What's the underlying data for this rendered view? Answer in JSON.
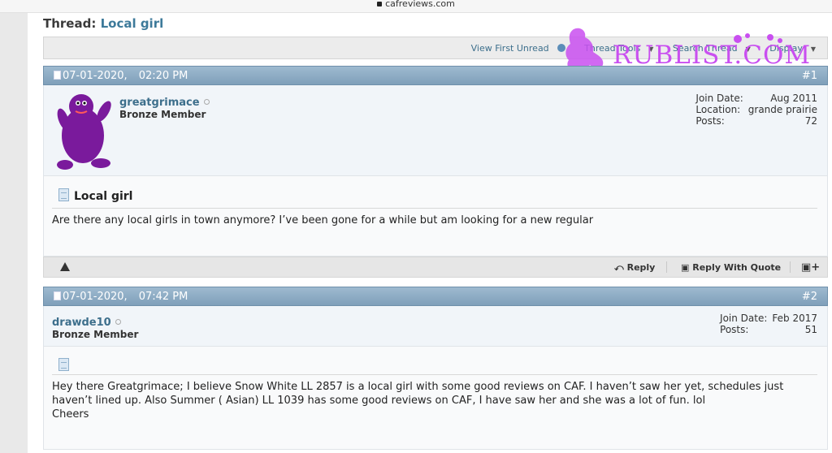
{
  "browser": {
    "url": "cafreviews.com"
  },
  "thread": {
    "label": "Thread:",
    "title": "Local girl",
    "toolbar": {
      "view_first_unread": "View First Unread",
      "thread_tools": "Thread Tools",
      "search_thread": "Search Thread",
      "display": "Display"
    }
  },
  "watermark": {
    "text": "RUBLIST.COM",
    "color": "#c94ff0"
  },
  "posts": [
    {
      "date": "07-01-2020,",
      "time": "02:20 PM",
      "number": "#1",
      "username": "greatgrimace",
      "rank": "Bronze Member",
      "stats": {
        "join_label": "Join Date:",
        "join_value": "Aug 2011",
        "location_label": "Location:",
        "location_value": "grande prairie",
        "posts_label": "Posts:",
        "posts_value": "72"
      },
      "title": "Local girl",
      "body": "Are there any local girls in town anymore? I’ve been gone for a while but am looking for a new regular",
      "actions": {
        "reply": "Reply",
        "reply_quote": "Reply With Quote"
      }
    },
    {
      "date": "07-01-2020,",
      "time": "07:42 PM",
      "number": "#2",
      "username": "drawde10",
      "rank": "Bronze Member",
      "stats": {
        "join_label": "Join Date:",
        "join_value": "Feb 2017",
        "posts_label": "Posts:",
        "posts_value": "51"
      },
      "body_line1": "Hey there Greatgrimace; I believe Snow White LL 2857 is a local girl with some good reviews on CAF. I haven’t saw her yet, schedules just",
      "body_line2": "haven’t lined up. Also Summer ( Asian) LL 1039 has some good reviews on CAF, I have saw her and she was a lot of fun. lol",
      "body_line3": "Cheers"
    }
  ],
  "colors": {
    "header_bar": "#8fadc6",
    "link": "#3d6f8c",
    "avatar": "#7a1a9c"
  }
}
